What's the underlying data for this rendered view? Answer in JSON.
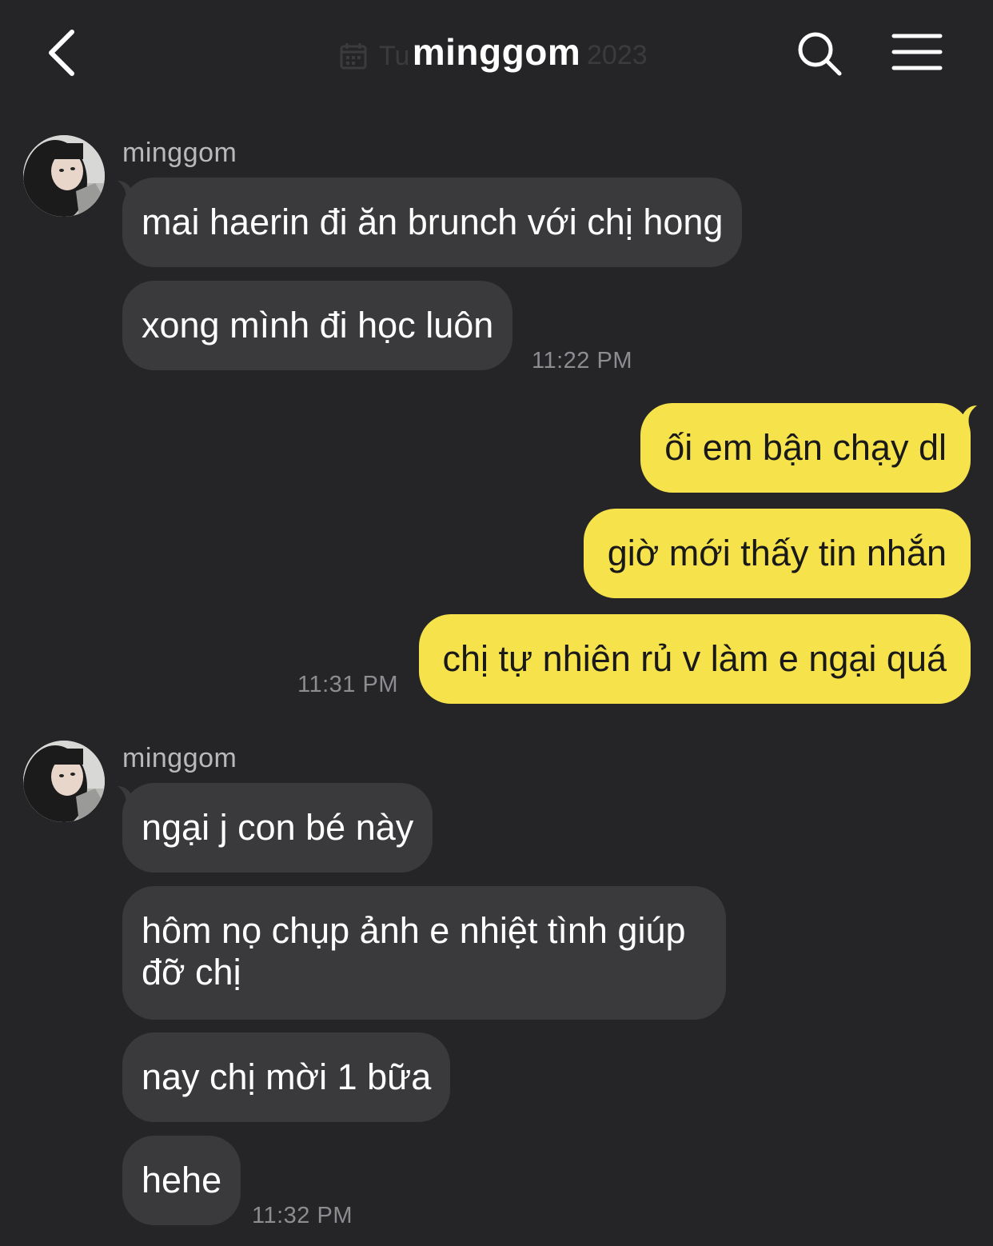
{
  "header": {
    "title": "minggom",
    "ghost_date_prefix": "Tu",
    "ghost_date_year": "2023"
  },
  "colors": {
    "background": "#252527",
    "incoming_bubble": "#3a3a3d",
    "outgoing_bubble": "#f6e24b",
    "timestamp": "#8d8d91"
  },
  "groups": [
    {
      "sender": "minggom",
      "messages": [
        "mai haerin đi ăn brunch với chị hong",
        "xong mình đi học luôn"
      ],
      "time": "11:22 PM"
    },
    {
      "sender": "me",
      "messages": [
        "ối em bận chạy dl",
        "giờ mới thấy tin nhắn",
        "chị tự nhiên rủ v làm e ngại quá"
      ],
      "time": "11:31 PM"
    },
    {
      "sender": "minggom",
      "messages": [
        "ngại j con bé này",
        "hôm nọ chụp ảnh e nhiệt tình giúp đỡ chị",
        "nay chị mời 1 bữa",
        "hehe"
      ],
      "time": "11:32 PM"
    }
  ]
}
